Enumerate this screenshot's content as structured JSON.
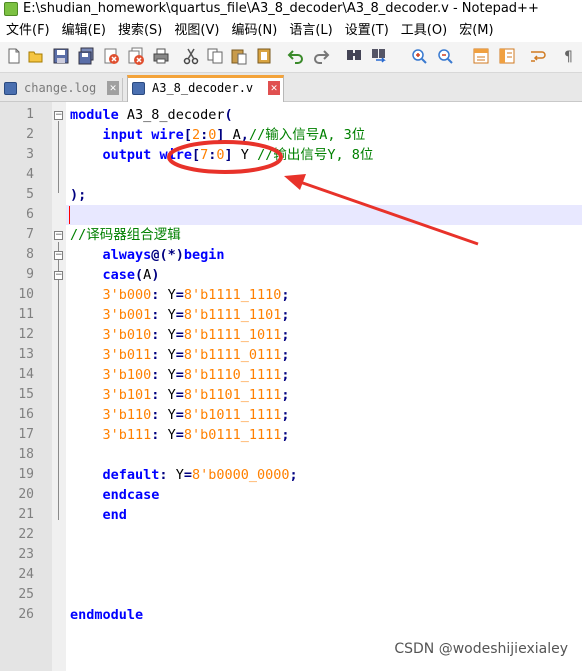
{
  "window": {
    "title": "E:\\shudian_homework\\quartus_file\\A3_8_decoder\\A3_8_decoder.v - Notepad++"
  },
  "menu": {
    "items": [
      "文件(F)",
      "编辑(E)",
      "搜索(S)",
      "视图(V)",
      "编码(N)",
      "语言(L)",
      "设置(T)",
      "工具(O)",
      "宏(M)"
    ]
  },
  "toolbar": {
    "icons": [
      "new-file-icon",
      "open-file-icon",
      "save-icon",
      "save-all-icon",
      "close-icon",
      "close-all-icon",
      "print-icon",
      "cut-icon",
      "copy-icon",
      "paste-icon",
      "undo-icon",
      "redo-icon",
      "find-icon",
      "replace-icon",
      "zoom-in-icon",
      "zoom-out-icon",
      "sync-vertical-icon",
      "sync-horizontal-icon",
      "word-wrap-icon"
    ]
  },
  "tabs": [
    {
      "label": "change.log",
      "active": false
    },
    {
      "label": "A3_8_decoder.v",
      "active": true
    }
  ],
  "editor": {
    "lines": [
      {
        "n": "1",
        "text": "module A3_8_decoder("
      },
      {
        "n": "2",
        "text": "    input wire[2:0] A,//输入信号A, 3位"
      },
      {
        "n": "3",
        "text": "    output wire[7:0] Y //输出信号Y, 8位"
      },
      {
        "n": "4",
        "text": ""
      },
      {
        "n": "5",
        "text": ");"
      },
      {
        "n": "6",
        "text": ""
      },
      {
        "n": "7",
        "text": "//译码器组合逻辑"
      },
      {
        "n": "8",
        "text": "    always@(*)begin"
      },
      {
        "n": "9",
        "text": "    case(A)"
      },
      {
        "n": "10",
        "text": "    3'b000: Y=8'b1111_1110;"
      },
      {
        "n": "11",
        "text": "    3'b001: Y=8'b1111_1101;"
      },
      {
        "n": "12",
        "text": "    3'b010: Y=8'b1111_1011;"
      },
      {
        "n": "13",
        "text": "    3'b011: Y=8'b1111_0111;"
      },
      {
        "n": "14",
        "text": "    3'b100: Y=8'b1110_1111;"
      },
      {
        "n": "15",
        "text": "    3'b101: Y=8'b1101_1111;"
      },
      {
        "n": "16",
        "text": "    3'b110: Y=8'b1011_1111;"
      },
      {
        "n": "17",
        "text": "    3'b111: Y=8'b0111_1111;"
      },
      {
        "n": "18",
        "text": ""
      },
      {
        "n": "19",
        "text": "    default: Y=8'b0000_0000;"
      },
      {
        "n": "20",
        "text": "    endcase"
      },
      {
        "n": "21",
        "text": "    end"
      },
      {
        "n": "22",
        "text": ""
      },
      {
        "n": "23",
        "text": ""
      },
      {
        "n": "24",
        "text": ""
      },
      {
        "n": "25",
        "text": ""
      },
      {
        "n": "26",
        "text": "endmodule"
      }
    ],
    "current_line": "6"
  },
  "annotation": {
    "color": "#e8322a",
    "ellipse_around": "wire[7:0]",
    "arrow": true
  },
  "watermark": "CSDN @wodeshijiexialey"
}
